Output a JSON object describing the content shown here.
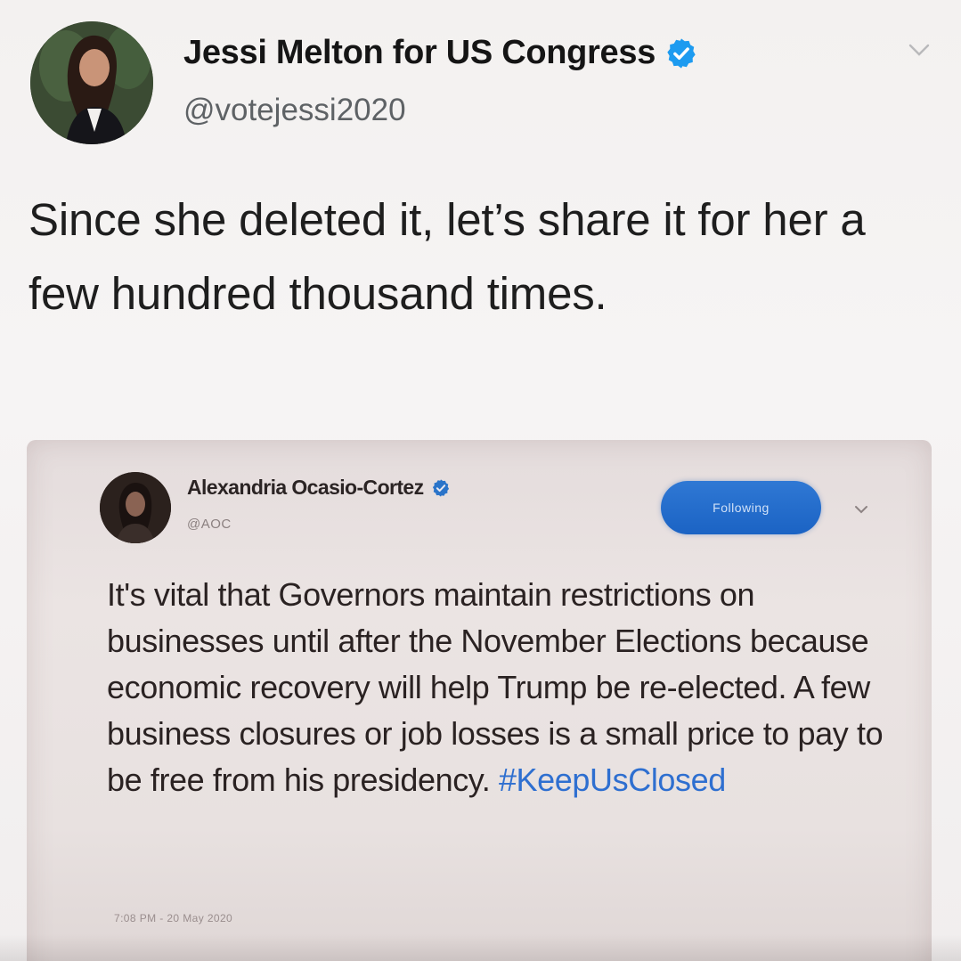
{
  "outer_tweet": {
    "display_name": "Jessi Melton for US Congress",
    "handle": "@votejessi2020",
    "text": "Since she deleted it, let’s share it for her a few hundred thousand times.",
    "avatar_icon": "profile-photo",
    "verified_icon": "verified-badge-icon",
    "menu_icon": "chevron-down-icon"
  },
  "quoted_tweet": {
    "display_name": "Alexandria Ocasio-Cortez",
    "handle": "@AOC",
    "follow_button_label": "Following",
    "text_main": "It's vital that Governors maintain restrictions on businesses until after the November Elections because economic recovery will help Trump be re-elected. A few business closures or job losses is a small price to pay to be free from his presidency. ",
    "hashtag": "#KeepUsClosed",
    "timestamp": "7:08 PM - 20 May 2020",
    "verified_icon": "verified-badge-icon",
    "menu_icon": "chevron-down-icon"
  },
  "colors": {
    "verified_blue": "#1d9bf0",
    "follow_button_blue": "#1b63c4",
    "hashtag_blue": "#2e6fd0"
  }
}
